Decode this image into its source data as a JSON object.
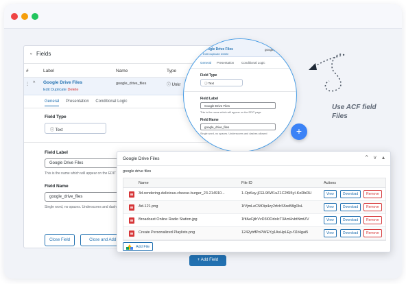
{
  "colors": {
    "accent": "#2271b1",
    "danger": "#d63638",
    "traffic": [
      "#ef4444",
      "#f59e0b",
      "#22c55e"
    ]
  },
  "panel": {
    "title": "Fields",
    "columns": [
      "#",
      "Label",
      "Name",
      "Type"
    ],
    "row": {
      "chevron": "^",
      "label": "Google Drive Files",
      "edit": "Edit",
      "duplicate": "Duplicate",
      "delete": "Delete",
      "name": "google_drive_files",
      "type": "Unkr"
    },
    "tabs": [
      "General",
      "Presentation",
      "Conditional Logic"
    ],
    "field_type_label": "Field Type",
    "field_type_value": "Text",
    "field_label_label": "Field Label",
    "field_label_value": "Google Drive Files",
    "field_label_hint": "This is the name which will appear on the EDIT p",
    "field_name_label": "Field Name",
    "field_name_value": "google_drive_files",
    "field_name_hint": "Single word, no spaces. Underscores and dashe",
    "close_field": "Close Field",
    "close_and_add": "Close and Add Field",
    "add_field": "+ Add Field"
  },
  "zoom": {
    "title": "Google Drive Files",
    "links": "Edit  Duplicate  Delete",
    "key": "google_d",
    "tabs": [
      "General",
      "Presentation",
      "Conditional Logic"
    ],
    "field_type_label": "Field Type",
    "field_type_value": "Text",
    "field_label_label": "Field Label",
    "field_label_value": "Google Drive Files",
    "field_label_hint": "This is the name which will appear on the EDIT page",
    "field_name_label": "Field Name",
    "field_name_value": "google_drive_files",
    "field_name_hint": "Single word, no spaces. Underscores and dashes allowed"
  },
  "fab_label": "+",
  "callout": [
    "Use ACF field",
    "Files"
  ],
  "front": {
    "title": "Google Drive Files",
    "subtitle": "google drive files",
    "controls": [
      "^",
      "v",
      "▴"
    ],
    "headers": {
      "name": "Name",
      "file_id": "File ID",
      "actions": "Actions"
    },
    "rows": [
      {
        "name": "3d-rendering-delicious-cheese-burger_23-214910...",
        "id": "1-OpKay-jFEL96W1uZ1C2f6l5yI-KoRbRU"
      },
      {
        "name": "Ad-121.png",
        "id": "1fVjmLeC5fOip4zy2rfchS5reB8g0IsL"
      },
      {
        "name": "Broadcast Online Radio Station.jpg",
        "id": "1fifAeFjthVvD3I0OdolcT3AmHvbtNmtZV"
      },
      {
        "name": "Create Personalized Playlists.png",
        "id": "1242ybffPoPWEYg1AxHpLEp-f11t4gai5"
      }
    ],
    "view": "View",
    "download": "Download",
    "remove": "Remove",
    "add_file": "Add File"
  }
}
